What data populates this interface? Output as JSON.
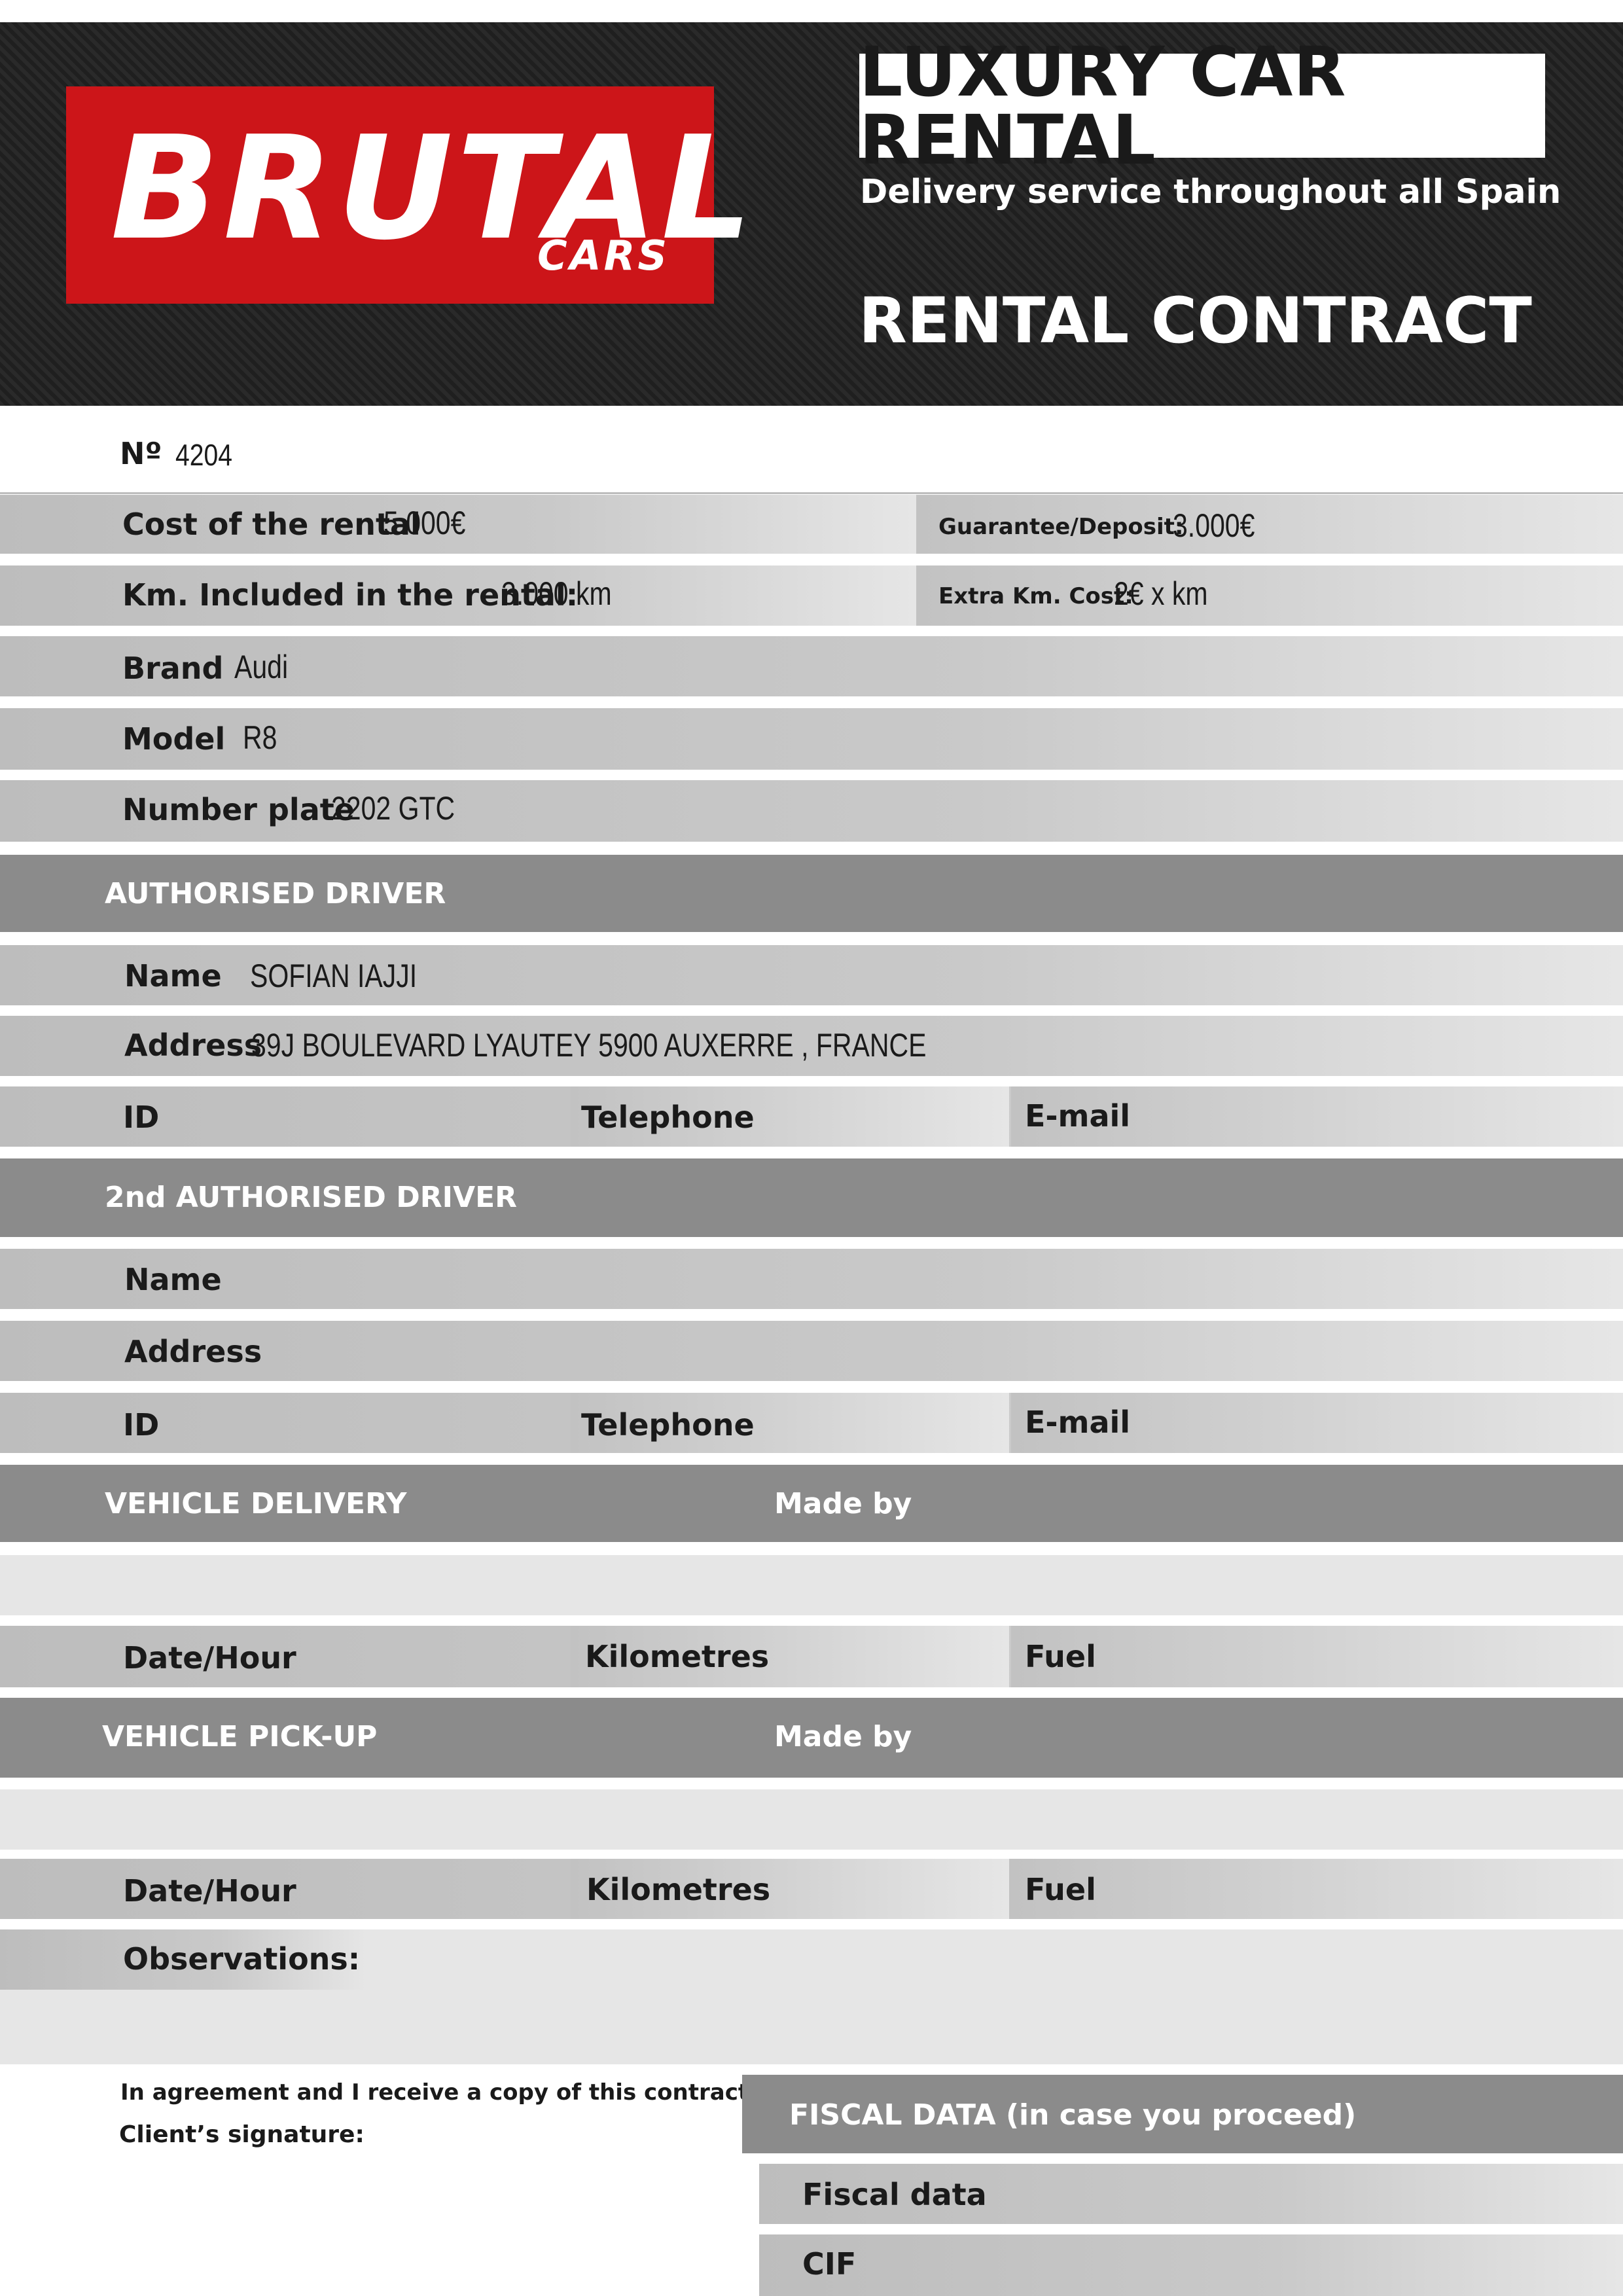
{
  "header": {
    "logo_main": "BRUTAL",
    "logo_sub": "CARS",
    "badge": "LUXURY CAR RENTAL",
    "tagline": "Delivery service throughout all Spain",
    "document_title": "RENTAL CONTRACT"
  },
  "contract": {
    "number_label": "Nº",
    "number_value": "4204"
  },
  "rental": {
    "cost_label": "Cost of the rental",
    "cost_value": "5.000€",
    "deposit_label": "Guarantee/Deposit:",
    "deposit_value": "3.000€",
    "km_label": "Km. Included in the rental:",
    "km_value": "3.000 km",
    "extra_km_label": "Extra Km. Cost:",
    "extra_km_value": "2€ x km"
  },
  "vehicle": {
    "brand_label": "Brand",
    "brand_value": "Audi",
    "model_label": "Model",
    "model_value": "R8",
    "plate_label": "Number plate",
    "plate_value": "2202 GTC"
  },
  "driver1": {
    "section_title": "AUTHORISED DRIVER",
    "name_label": "Name",
    "name_value": "SOFIAN IAJJI",
    "address_label": "Address",
    "address_value": "39J BOULEVARD LYAUTEY 5900 AUXERRE , FRANCE",
    "id_label": "ID",
    "telephone_label": "Telephone",
    "email_label": "E-mail"
  },
  "driver2": {
    "section_title": "2nd AUTHORISED DRIVER",
    "name_label": "Name",
    "address_label": "Address",
    "id_label": "ID",
    "telephone_label": "Telephone",
    "email_label": "E-mail"
  },
  "delivery": {
    "section_title": "VEHICLE DELIVERY",
    "made_by_label": "Made by",
    "date_label": "Date/Hour",
    "km_label": "Kilometres",
    "fuel_label": "Fuel"
  },
  "pickup": {
    "section_title": "VEHICLE PICK-UP",
    "made_by_label": "Made by",
    "date_label": "Date/Hour",
    "km_label": "Kilometres",
    "fuel_label": "Fuel"
  },
  "observations": {
    "label": "Observations:"
  },
  "signature": {
    "agreement_text": "In agreement and I receive a copy of this contract,",
    "signature_label": "Client’s signature:"
  },
  "fiscal": {
    "section_title": "FISCAL DATA (in case you proceed)",
    "fiscal_data_label": "Fiscal data",
    "cif_label": "CIF"
  },
  "colors": {
    "brand_red": "#cc1519",
    "header_dark": "#242424",
    "section_gray": "#8b8b8b",
    "row_gray": "#e6e6e6"
  }
}
